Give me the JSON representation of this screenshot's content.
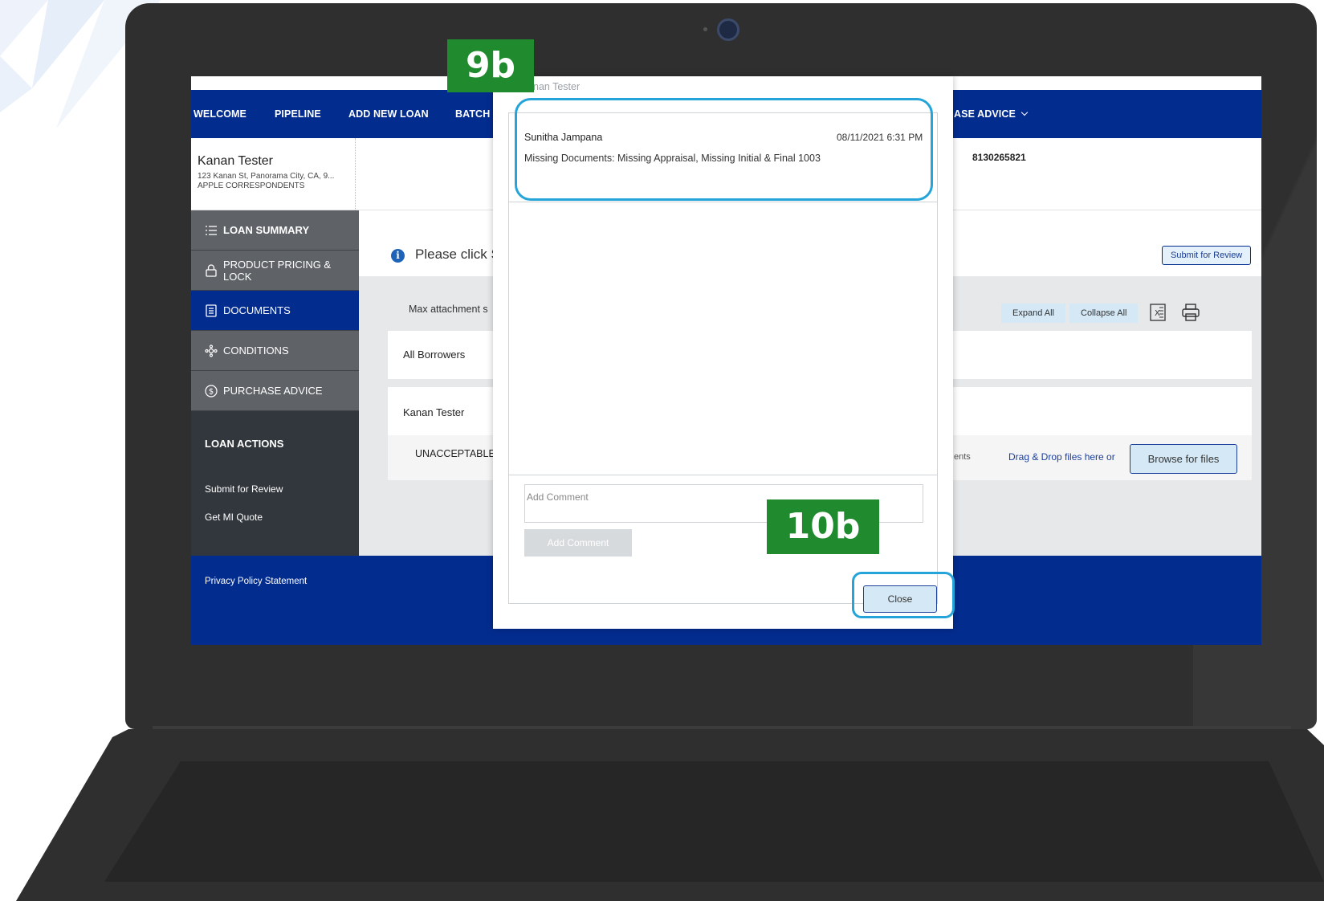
{
  "callouts": {
    "step_9b": "9b",
    "step_10b": "10b"
  },
  "nav": {
    "items": [
      "WELCOME",
      "PIPELINE",
      "ADD NEW LOAN",
      "BATCH",
      "ASE ADVICE"
    ]
  },
  "borrower": {
    "name": "Kanan Tester",
    "address": "123 Kanan St, Panorama City, CA, 9...",
    "company": "APPLE CORRESPONDENTS",
    "loan_number": "8130265821"
  },
  "sidebar": {
    "items": [
      {
        "label": "LOAN SUMMARY",
        "icon": "list-icon",
        "active": false
      },
      {
        "label": "PRODUCT PRICING & LOCK",
        "icon": "lock-icon",
        "active": false
      },
      {
        "label": "DOCUMENTS",
        "icon": "document-icon",
        "active": true
      },
      {
        "label": "CONDITIONS",
        "icon": "conditions-icon",
        "active": false
      },
      {
        "label": "PURCHASE ADVICE",
        "icon": "dollar-icon",
        "active": false
      }
    ],
    "actions_title": "LOAN ACTIONS",
    "actions": [
      "Submit for Review",
      "Get MI Quote"
    ]
  },
  "content": {
    "notice": "Please click S",
    "submit_label": "Submit for Review",
    "max_attachment": "Max attachment s",
    "expand_label": "Expand All",
    "collapse_label": "Collapse All",
    "panel_all": "All Borrowers",
    "panel_borrower": "Kanan Tester",
    "doc_status": "UNACCEPTABLE",
    "ents_fragment": "ents",
    "drag_drop": "Drag & Drop files here or",
    "browse_label": "Browse for files"
  },
  "footer": {
    "privacy": "Privacy Policy Statement"
  },
  "modal": {
    "title": "nan Tester",
    "comment": {
      "author": "Sunitha Jampana",
      "date": "08/11/2021 6:31 PM",
      "text": "Missing Documents: Missing Appraisal, Missing Initial & Final 1003"
    },
    "input_placeholder": "Add Comment",
    "add_button": "Add Comment",
    "close_button": "Close"
  },
  "colors": {
    "brand_navy": "#032c8f",
    "sidebar_grey": "#5f6368",
    "callout_blue": "#25a4d9",
    "step_green": "#1f8a2e"
  }
}
